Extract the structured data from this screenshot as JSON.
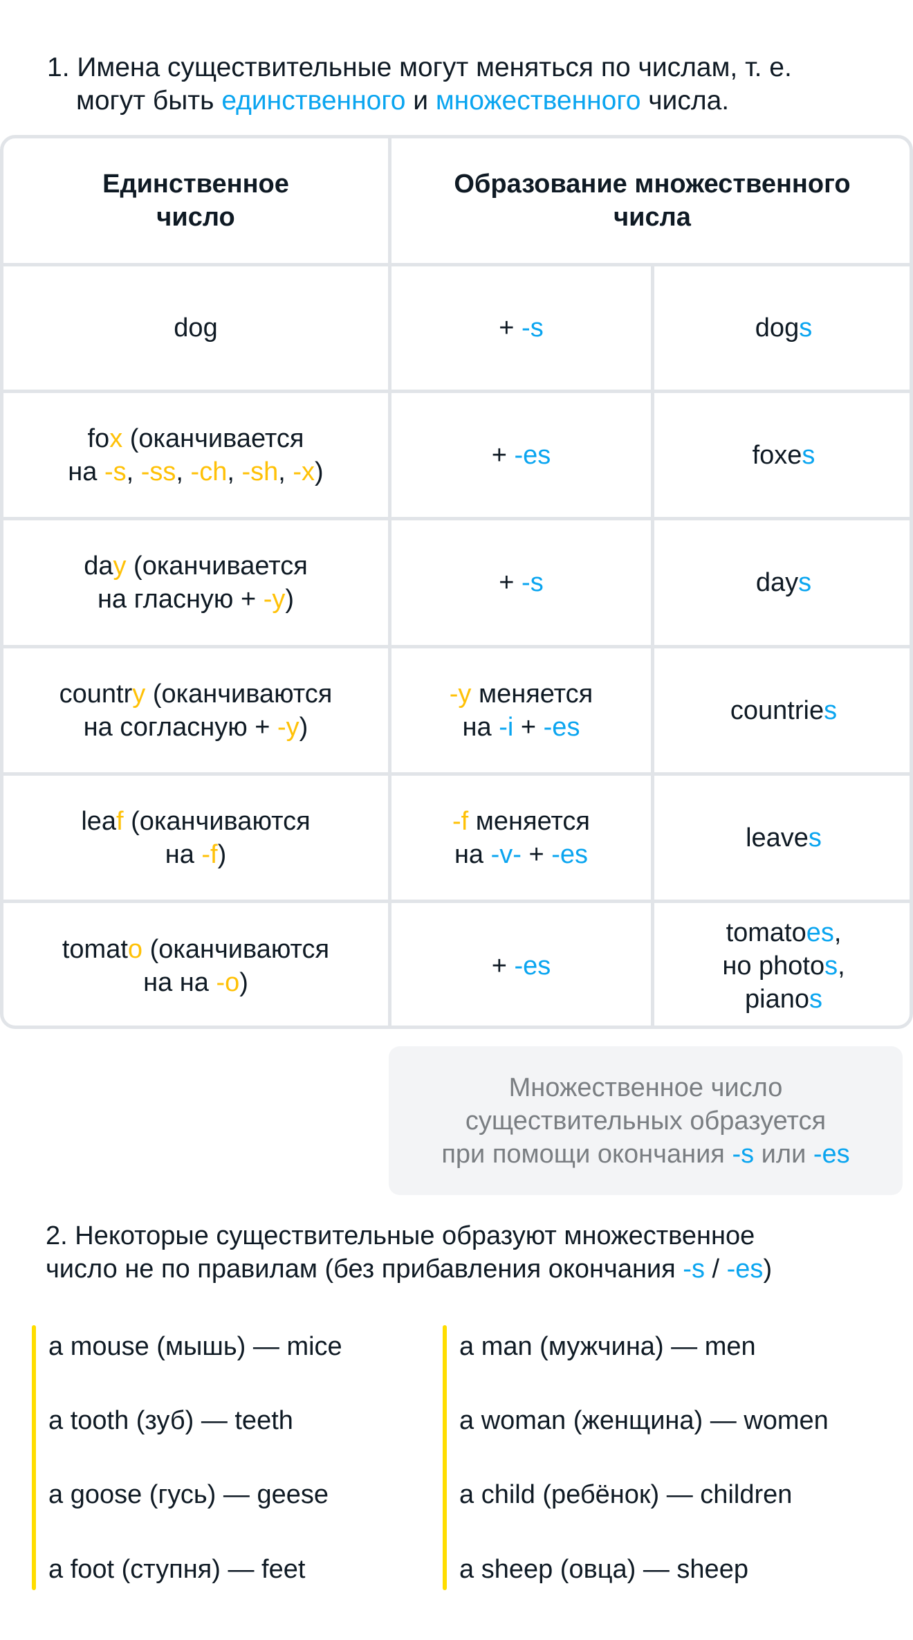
{
  "intro": {
    "number": "1.",
    "line1": "Имена существительные могут меняться по числам, т. е.",
    "line2_pre": "могут быть ",
    "singular_word": "единственного",
    "line2_mid": " и ",
    "plural_word": "множественного",
    "line2_post": " числа."
  },
  "table": {
    "headers": {
      "singular": [
        "Единственное",
        "число"
      ],
      "plural": [
        "Образование множественного",
        "числа"
      ]
    },
    "rows": [
      {
        "singular": [
          [
            "dog",
            ""
          ]
        ],
        "rule": [
          [
            "+ ",
            ""
          ],
          [
            "-s",
            "blue"
          ]
        ],
        "plural": [
          [
            "dog",
            ""
          ],
          [
            "s",
            "blue"
          ]
        ]
      },
      {
        "singular": [
          [
            "fo",
            ""
          ],
          [
            "x",
            "yellow"
          ],
          [
            " (оканчивается",
            ""
          ],
          [
            "\n",
            ""
          ],
          [
            "на ",
            ""
          ],
          [
            "-s",
            "yellow"
          ],
          [
            ", ",
            ""
          ],
          [
            "-ss",
            "yellow"
          ],
          [
            ", ",
            ""
          ],
          [
            "-ch",
            "yellow"
          ],
          [
            ", ",
            ""
          ],
          [
            "-sh",
            "yellow"
          ],
          [
            ", ",
            ""
          ],
          [
            "-x",
            "yellow"
          ],
          [
            ")",
            ""
          ]
        ],
        "rule": [
          [
            "+ ",
            ""
          ],
          [
            "-es",
            "blue"
          ]
        ],
        "plural": [
          [
            "foxe",
            ""
          ],
          [
            "s",
            "blue"
          ]
        ]
      },
      {
        "singular": [
          [
            "da",
            ""
          ],
          [
            "y",
            "yellow"
          ],
          [
            " (оканчивается",
            ""
          ],
          [
            "\n",
            ""
          ],
          [
            "на гласную + ",
            ""
          ],
          [
            "-y",
            "yellow"
          ],
          [
            ")",
            ""
          ]
        ],
        "rule": [
          [
            "+ ",
            ""
          ],
          [
            "-s",
            "blue"
          ]
        ],
        "plural": [
          [
            "day",
            ""
          ],
          [
            "s",
            "blue"
          ]
        ]
      },
      {
        "singular": [
          [
            "countr",
            ""
          ],
          [
            "y",
            "yellow"
          ],
          [
            " (оканчиваются",
            ""
          ],
          [
            "\n",
            ""
          ],
          [
            "на согласную + ",
            ""
          ],
          [
            "-y",
            "yellow"
          ],
          [
            ")",
            ""
          ]
        ],
        "rule": [
          [
            "-y",
            "yellow"
          ],
          [
            " меняется",
            ""
          ],
          [
            "\n",
            ""
          ],
          [
            "на ",
            ""
          ],
          [
            "-i",
            "blue"
          ],
          [
            " + ",
            ""
          ],
          [
            "-es",
            "blue"
          ]
        ],
        "plural": [
          [
            "countrie",
            ""
          ],
          [
            "s",
            "blue"
          ]
        ]
      },
      {
        "singular": [
          [
            "lea",
            ""
          ],
          [
            "f",
            "yellow"
          ],
          [
            " (оканчиваются",
            ""
          ],
          [
            "\n",
            ""
          ],
          [
            "на ",
            ""
          ],
          [
            "-f",
            "yellow"
          ],
          [
            ")",
            ""
          ]
        ],
        "rule": [
          [
            "-f",
            "yellow"
          ],
          [
            " меняется",
            ""
          ],
          [
            "\n",
            ""
          ],
          [
            "на ",
            ""
          ],
          [
            "-v-",
            "blue"
          ],
          [
            " + ",
            ""
          ],
          [
            "-es",
            "blue"
          ]
        ],
        "plural": [
          [
            "leave",
            ""
          ],
          [
            "s",
            "blue"
          ]
        ]
      },
      {
        "singular": [
          [
            "tomat",
            ""
          ],
          [
            "o",
            "yellow"
          ],
          [
            " (оканчиваются",
            ""
          ],
          [
            "\n",
            ""
          ],
          [
            "на на ",
            ""
          ],
          [
            "-o",
            "yellow"
          ],
          [
            ")",
            ""
          ]
        ],
        "rule": [
          [
            "+ ",
            ""
          ],
          [
            "-es",
            "blue"
          ]
        ],
        "plural": [
          [
            "tomato",
            ""
          ],
          [
            "es",
            "blue"
          ],
          [
            ",",
            ""
          ],
          [
            "\n",
            ""
          ],
          [
            "но photo",
            ""
          ],
          [
            "s",
            "blue"
          ],
          [
            ",",
            ""
          ],
          [
            "\n",
            ""
          ],
          [
            "piano",
            ""
          ],
          [
            "s",
            "blue"
          ]
        ]
      }
    ]
  },
  "note": {
    "line1": "Множественное число",
    "line2": "существительных образуется",
    "line3_pre": "при помощи окончания ",
    "suffix_s": "-s",
    "line3_mid": " или ",
    "suffix_es": "-es"
  },
  "section2": {
    "line1": "2. Некоторые существительные образуют множественное",
    "line2_pre": "число не по правилам (без прибавления окончания ",
    "suffix_s": "-s",
    "slash": " / ",
    "suffix_es": "-es",
    "close": ")"
  },
  "irregular": {
    "left": [
      "a mouse (мышь) — mice",
      "a tooth (зуб) — teeth",
      "a goose (гусь) — geese",
      "a foot (ступня) — feet"
    ],
    "right": [
      "a man (мужчина) — men",
      "a woman (женщина) — women",
      "a child (ребёнок) — children",
      "a sheep (овца) — sheep"
    ]
  },
  "colors": {
    "text": "#0F1A24",
    "accent_blue": "#0AA5F0",
    "accent_yellow": "#FFC107",
    "bar_yellow": "#FFDD00",
    "border": "#E1E4E8",
    "note_bg": "#F3F4F6",
    "note_text": "#7A7E82"
  }
}
